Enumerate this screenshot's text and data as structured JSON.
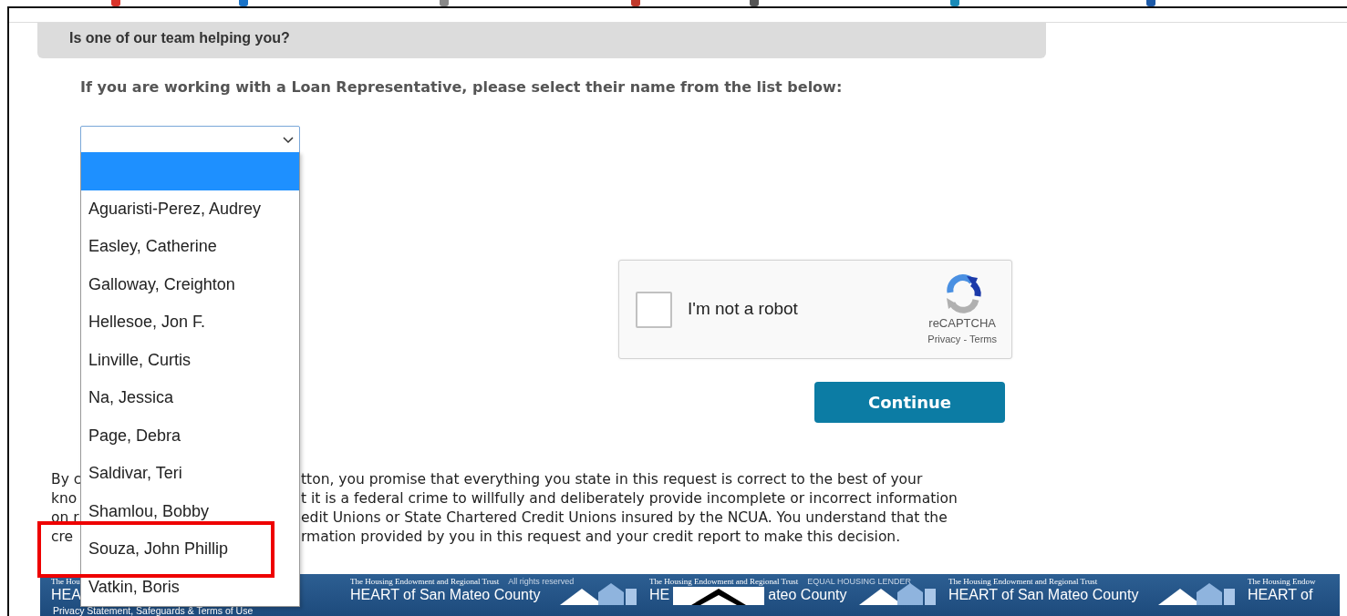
{
  "section_header": "Is one of our team helping you?",
  "prompt": "If you are working with a Loan Representative, please select their name from the list below:",
  "rep_select": {
    "expanded": true,
    "options": [
      {
        "selected": true
      },
      {
        "label": "Aguaristi-Perez, Audrey",
        "selected": false
      },
      {
        "label": "Easley, Catherine",
        "selected": false
      },
      {
        "label": "Galloway, Creighton",
        "selected": false
      },
      {
        "label": "Hellesoe, Jon F.",
        "selected": false
      },
      {
        "label": "Linville, Curtis",
        "selected": false
      },
      {
        "label": "Na, Jessica",
        "selected": false
      },
      {
        "label": "Page, Debra",
        "selected": false
      },
      {
        "label": "Saldivar, Teri",
        "selected": false
      },
      {
        "label": "Shamlou, Bobby",
        "selected": false
      },
      {
        "label": "Souza, John Phillip",
        "selected": false,
        "highlighted": true
      },
      {
        "label": "Vatkin, Boris",
        "selected": false
      }
    ]
  },
  "captcha": {
    "checked": false,
    "label": "I'm not a robot",
    "brand": "reCAPTCHA",
    "links": [
      "Privacy",
      "Terms"
    ],
    "separator": "-"
  },
  "continue_button": "Continue",
  "disclaimer_lines": [
    {
      "left": "By c",
      "right": "tton, you promise that everything you state in this request is correct to the best of your"
    },
    {
      "left": "kno",
      "right": "t it is a federal crime to willfully and deliberately provide incomplete or incorrect information"
    },
    {
      "left": "on r",
      "right": "edit Unions or State Chartered Credit Unions insured by the NCUA. You understand that the"
    },
    {
      "left": "cre",
      "right": "rmation provided by you in this request and your credit report to make this decision."
    }
  ],
  "footer": {
    "tiles": [
      {
        "subtitle": "The Hou",
        "title": [
          "HEA"
        ]
      },
      {
        "subtitle": "The Housing Endowment and Regional Trust",
        "title": [
          "HEART of San Mateo County"
        ],
        "overlay": "All rights reserved"
      },
      {
        "subtitle": "The Housing Endowment and Regional Trust",
        "title": [
          "HE",
          "ateo County"
        ],
        "logo": true,
        "overlay": "EQUAL HOUSING LENDER"
      },
      {
        "subtitle": "The Housing Endowment and Regional Trust",
        "title": [
          "HEART of San Mateo County"
        ]
      },
      {
        "subtitle": "The Housing Endow",
        "title": [
          "HEART of"
        ]
      }
    ],
    "links": "Privacy Statement, Safeguards & Terms of Use"
  }
}
